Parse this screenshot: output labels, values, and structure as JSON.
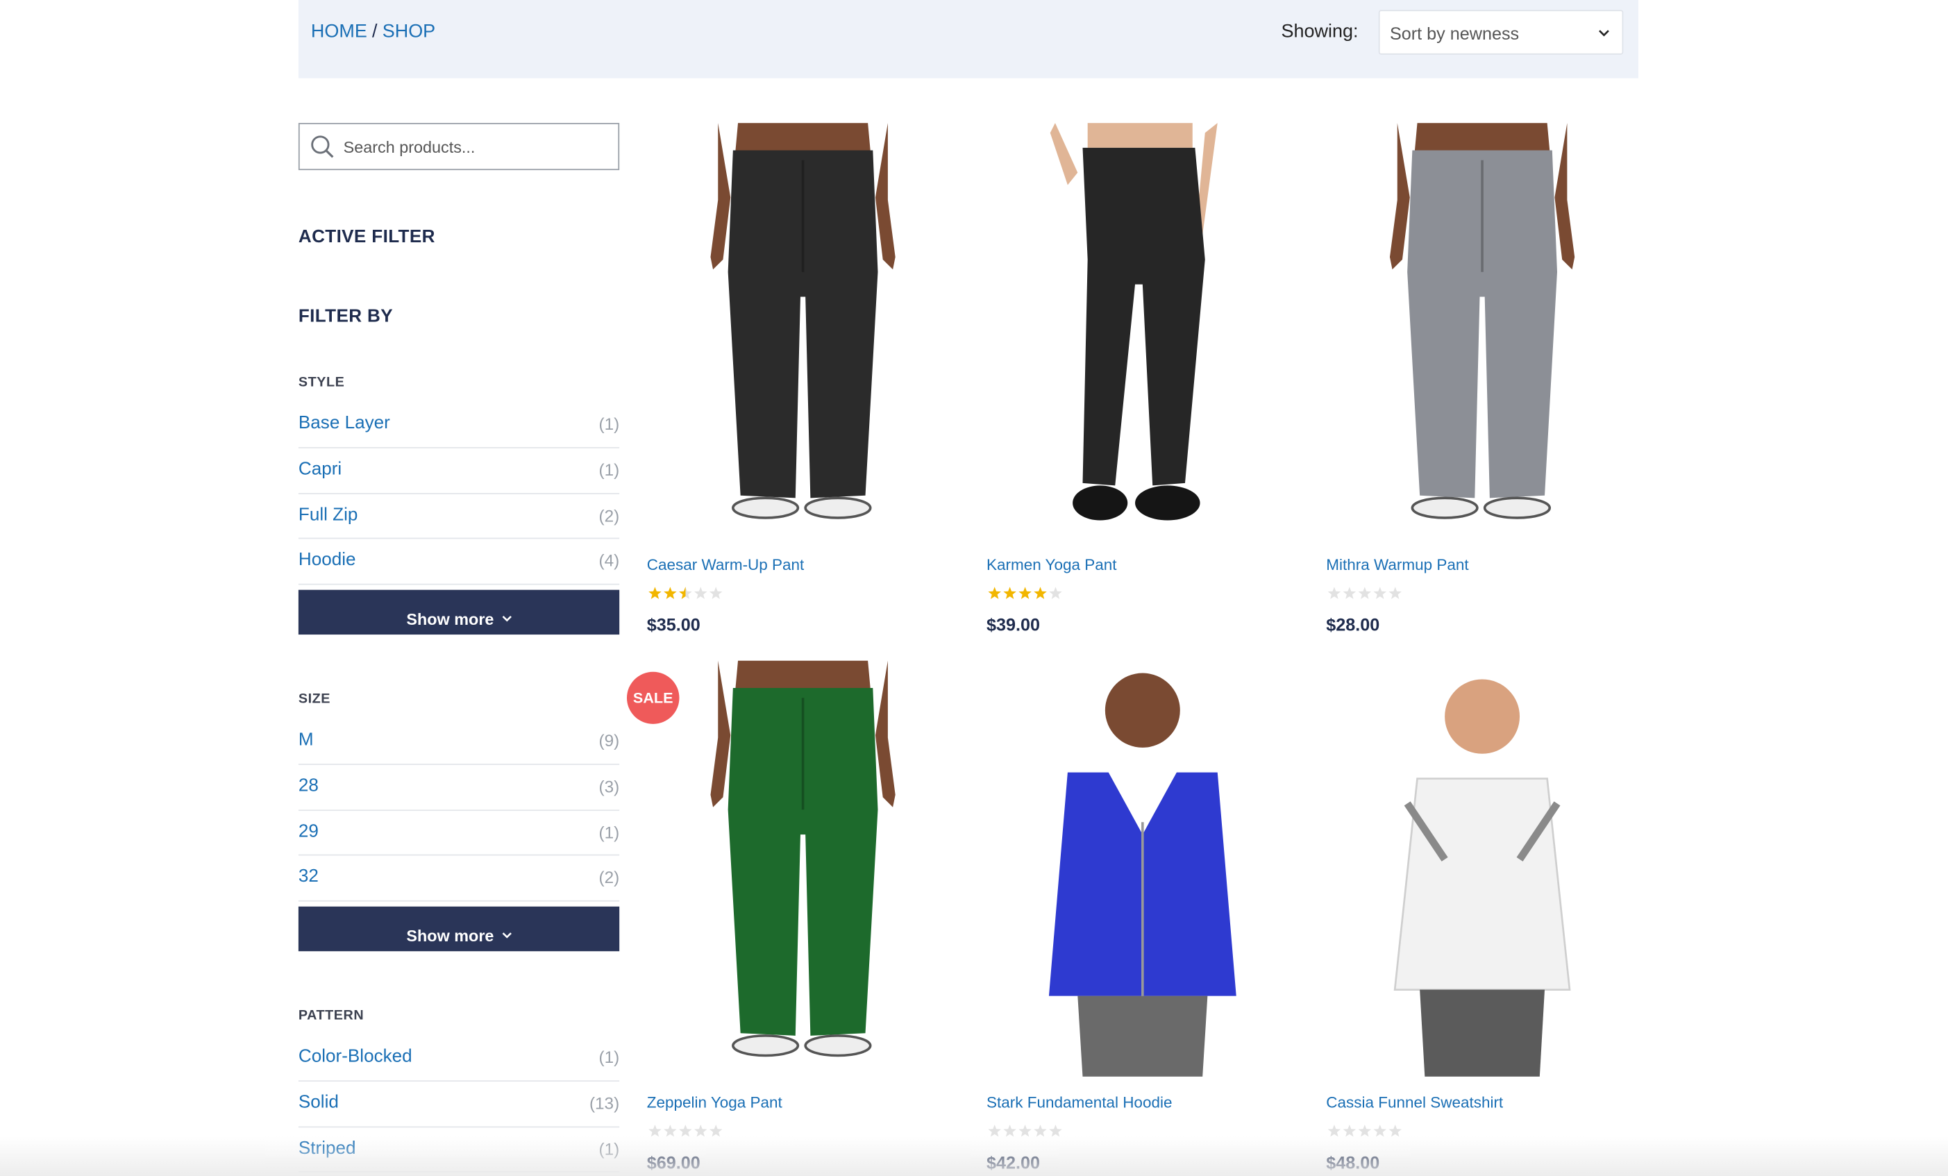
{
  "breadcrumb": {
    "home": "HOME",
    "separator": "/",
    "shop": "SHOP"
  },
  "sort": {
    "label": "Showing:",
    "selected": "Sort by newness"
  },
  "search": {
    "placeholder": "Search products..."
  },
  "sidebar": {
    "active_filter_heading": "ACTIVE FILTER",
    "filter_by_heading": "FILTER BY",
    "groups": [
      {
        "title": "STYLE",
        "show_more": "Show more",
        "items": [
          {
            "label": "Base Layer",
            "count": "(1)"
          },
          {
            "label": "Capri",
            "count": "(1)"
          },
          {
            "label": "Full Zip",
            "count": "(2)"
          },
          {
            "label": "Hoodie",
            "count": "(4)"
          }
        ]
      },
      {
        "title": "SIZE",
        "show_more": "Show more",
        "items": [
          {
            "label": "M",
            "count": "(9)"
          },
          {
            "label": "28",
            "count": "(3)"
          },
          {
            "label": "29",
            "count": "(1)"
          },
          {
            "label": "32",
            "count": "(2)"
          }
        ]
      },
      {
        "title": "PATTERN",
        "items": [
          {
            "label": "Color-Blocked",
            "count": "(1)"
          },
          {
            "label": "Solid",
            "count": "(13)"
          },
          {
            "label": "Striped",
            "count": "(1)"
          }
        ]
      }
    ]
  },
  "products": [
    {
      "name": "Caesar Warm-Up Pant",
      "price": "$35.00",
      "rating": 2.5,
      "color": "#2b2b2b",
      "type": "pant-man"
    },
    {
      "name": "Karmen Yoga Pant",
      "price": "$39.00",
      "rating": 4,
      "color": "#262626",
      "type": "pant-woman"
    },
    {
      "name": "Mithra Warmup Pant",
      "price": "$28.00",
      "rating": 0,
      "color": "#8c8f96",
      "type": "pant-man"
    },
    {
      "name": "Zeppelin Yoga Pant",
      "price": "$69.00",
      "rating": 0,
      "color": "#1d6a2c",
      "type": "pant-man",
      "badge": "SALE"
    },
    {
      "name": "Stark Fundamental Hoodie",
      "price": "$42.00",
      "rating": 0,
      "color": "#2e3ad0",
      "type": "hoodie"
    },
    {
      "name": "Cassia Funnel Sweatshirt",
      "price": "$48.00",
      "rating": 0,
      "color": "#f2f2f2",
      "type": "sweatshirt"
    }
  ],
  "colors": {
    "link": "#1a6fb5",
    "heading": "#1e2b4d",
    "button": "#2a3558",
    "topbar": "#eef2f9",
    "sale": "#ef5a5a",
    "star": "#f2b600",
    "star_empty": "#e2e2e2"
  }
}
